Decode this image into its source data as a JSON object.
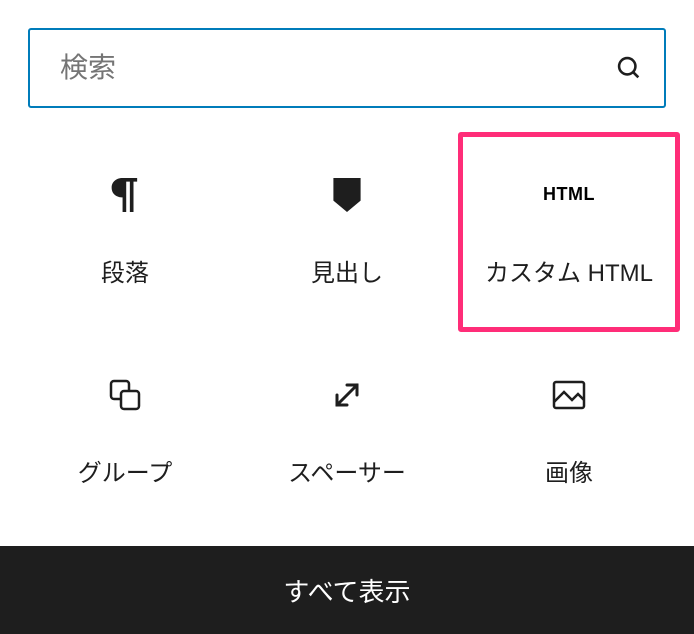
{
  "search": {
    "placeholder": "検索"
  },
  "blocks": [
    {
      "name": "paragraph",
      "label": "段落",
      "highlighted": false
    },
    {
      "name": "heading",
      "label": "見出し",
      "highlighted": false
    },
    {
      "name": "custom-html",
      "label": "カスタム HTML",
      "highlighted": true,
      "iconText": "HTML"
    },
    {
      "name": "group",
      "label": "グループ",
      "highlighted": false
    },
    {
      "name": "spacer",
      "label": "スペーサー",
      "highlighted": false
    },
    {
      "name": "image",
      "label": "画像",
      "highlighted": false
    }
  ],
  "footer": {
    "showAll": "すべて表示"
  }
}
